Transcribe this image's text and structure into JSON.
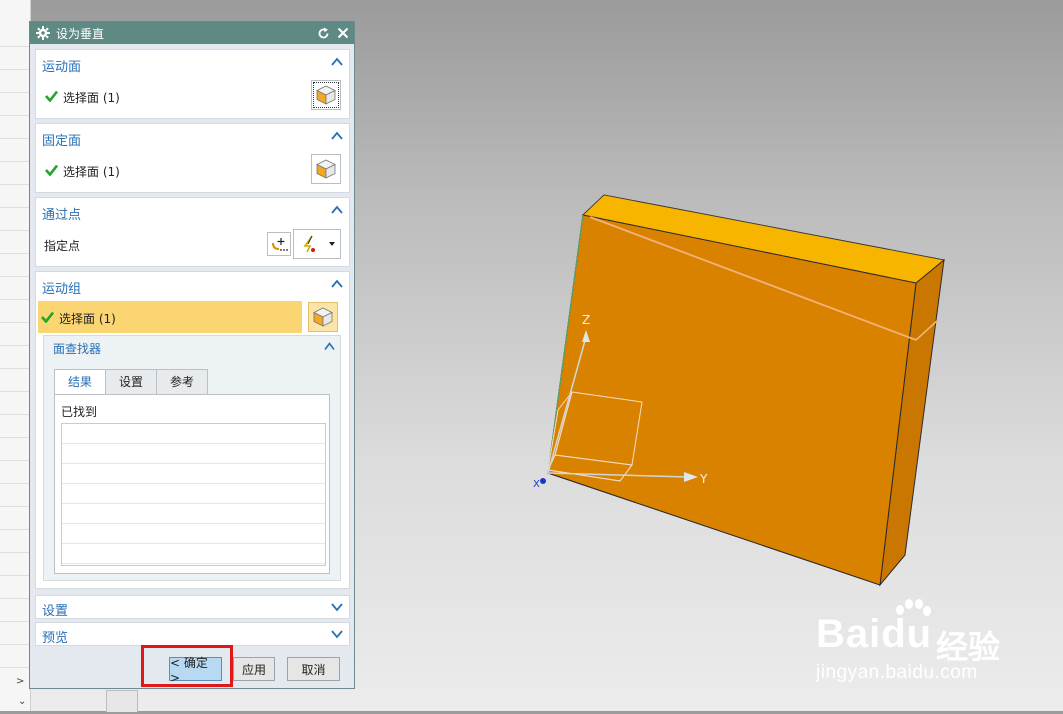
{
  "dialog": {
    "title": "设为垂直",
    "sections": {
      "motion_face": {
        "label": "运动面",
        "row_text": "选择面 (1)"
      },
      "fixed_face": {
        "label": "固定面",
        "row_text": "选择面 (1)"
      },
      "through_point": {
        "label": "通过点",
        "row_text": "指定点"
      },
      "motion_group": {
        "label": "运动组",
        "row_text": "选择面 (1)"
      }
    },
    "face_finder": {
      "label": "面查找器",
      "tabs": [
        "结果",
        "设置",
        "参考"
      ],
      "active_tab": "结果",
      "found_label": "已找到"
    },
    "settings_label": "设置",
    "preview_label": "预览",
    "buttons": {
      "ok": "< 确定 >",
      "apply": "应用",
      "cancel": "取消"
    }
  },
  "viewport": {
    "axes": {
      "z": "Z",
      "y": "Y",
      "x": "X"
    },
    "part_color": "#d98200"
  },
  "watermark": {
    "brand": "Baidu",
    "product": "经验",
    "url": "jingyan.baidu.com"
  },
  "colors": {
    "title_bar": "#5f8a83",
    "section_label": "#2a6fb4",
    "highlight_row": "#fad572",
    "ok_button": "#b7d9f2",
    "annotation_box": "#e01818"
  }
}
